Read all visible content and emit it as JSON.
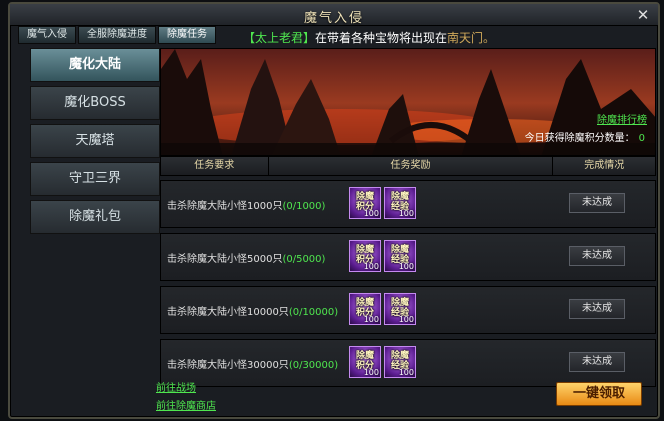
{
  "window": {
    "title": "魔气入侵",
    "close_icon": "close-icon"
  },
  "tabs": [
    {
      "label": "魔气入侵",
      "active": false
    },
    {
      "label": "全服除魔进度",
      "active": false
    },
    {
      "label": "除魔任务",
      "active": true
    }
  ],
  "ticker": {
    "name": "【太上老君】",
    "text": "在带着各种宝物将出现在",
    "tail": "南天门。"
  },
  "nav": [
    {
      "label": "魔化大陆",
      "active": true
    },
    {
      "label": "魔化BOSS",
      "active": false
    },
    {
      "label": "天魔塔",
      "active": false
    },
    {
      "label": "守卫三界",
      "active": false
    },
    {
      "label": "除魔礼包",
      "active": false
    }
  ],
  "banner": {
    "rank_link": "除魔排行榜",
    "score_label": "今日获得除魔积分数量：",
    "score_value": "0"
  },
  "table": {
    "headers": [
      "任务要求",
      "任务奖励",
      "完成情况"
    ],
    "rows": [
      {
        "req": "击杀除魔大陆小怪1000只",
        "progress": "(0/1000)",
        "status": "未达成"
      },
      {
        "req": "击杀除魔大陆小怪5000只",
        "progress": "(0/5000)",
        "status": "未达成"
      },
      {
        "req": "击杀除魔大陆小怪10000只",
        "progress": "(0/10000)",
        "status": "未达成"
      },
      {
        "req": "击杀除魔大陆小怪30000只",
        "progress": "(0/30000)",
        "status": "未达成"
      }
    ],
    "rewards": [
      {
        "line1": "除魔",
        "line2": "积分",
        "qty": "100"
      },
      {
        "line1": "除魔",
        "line2": "经验",
        "qty": "100"
      }
    ]
  },
  "footer": {
    "link1": "前往战场",
    "link2": "前往除魔商店",
    "claim": "一键领取"
  }
}
